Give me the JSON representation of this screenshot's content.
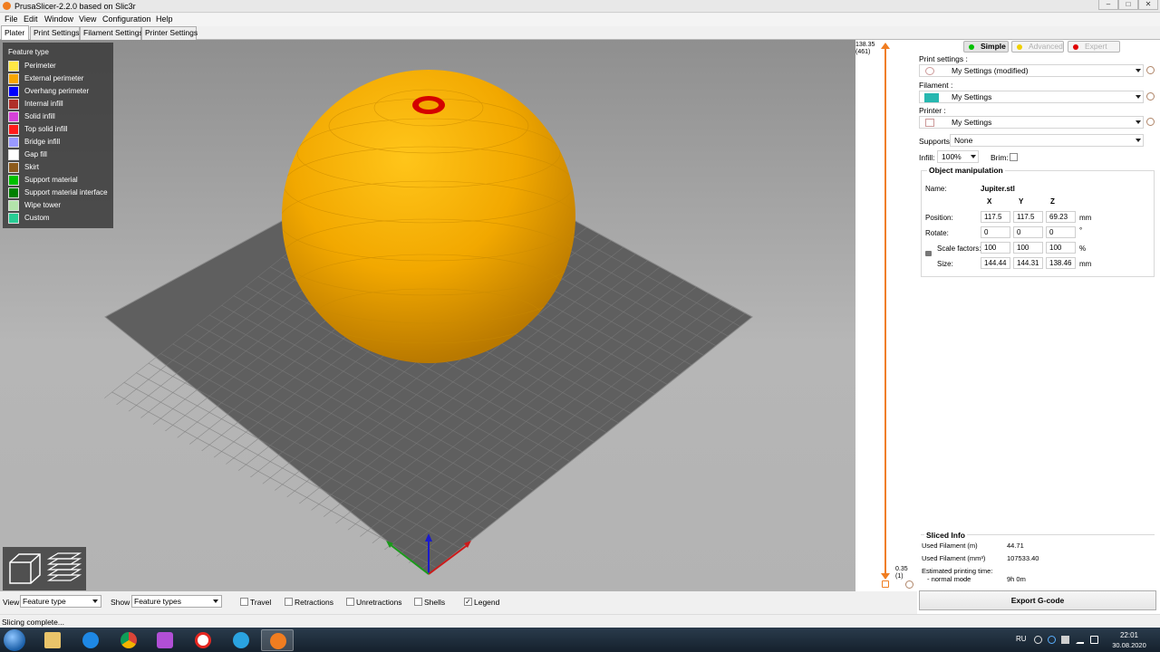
{
  "window": {
    "title": "PrusaSlicer-2.2.0 based on Slic3r"
  },
  "menu": {
    "items": [
      "File",
      "Edit",
      "Window",
      "View",
      "Configuration",
      "Help"
    ]
  },
  "tabs": [
    "Plater",
    "Print Settings",
    "Filament Settings",
    "Printer Settings"
  ],
  "legend": {
    "title": "Feature type",
    "items": [
      {
        "label": "Perimeter",
        "color": "#FFE845"
      },
      {
        "label": "External perimeter",
        "color": "#F7A600"
      },
      {
        "label": "Overhang perimeter",
        "color": "#0000FF"
      },
      {
        "label": "Internal infill",
        "color": "#B03029"
      },
      {
        "label": "Solid infill",
        "color": "#D641D9"
      },
      {
        "label": "Top solid infill",
        "color": "#FF1A1A"
      },
      {
        "label": "Bridge infill",
        "color": "#9999FF"
      },
      {
        "label": "Gap fill",
        "color": "#FFFFFF"
      },
      {
        "label": "Skirt",
        "color": "#8C5A1B"
      },
      {
        "label": "Support material",
        "color": "#00C000"
      },
      {
        "label": "Support material interface",
        "color": "#008000"
      },
      {
        "label": "Wipe tower",
        "color": "#B3E3AB"
      },
      {
        "label": "Custom",
        "color": "#28CC94"
      }
    ]
  },
  "layer_slider": {
    "top_height": "138.35",
    "top_layer": "(461)",
    "bottom_height": "0.35",
    "bottom_layer": "(1)"
  },
  "sidebar": {
    "modes": [
      {
        "label": "Simple",
        "color": "#00C000"
      },
      {
        "label": "Advanced",
        "color": "#F0D000"
      },
      {
        "label": "Expert",
        "color": "#E00000"
      }
    ],
    "print_settings_label": "Print settings :",
    "print_settings_value": "My Settings (modified)",
    "filament_label": "Filament :",
    "filament_value": "My Settings",
    "filament_color": "#27B7B0",
    "printer_label": "Printer :",
    "printer_value": "My Settings",
    "supports_label": "Supports:",
    "supports_value": "None",
    "infill_label": "Infill:",
    "infill_value": "100%",
    "brim_label": "Brim:",
    "object_manipulation": {
      "title": "Object manipulation",
      "name_label": "Name:",
      "name_value": "Jupiter.stl",
      "axis_x": "X",
      "axis_y": "Y",
      "axis_z": "Z",
      "position_label": "Position:",
      "position": [
        "117.5",
        "117.5",
        "69.23"
      ],
      "position_unit": "mm",
      "rotate_label": "Rotate:",
      "rotate": [
        "0",
        "0",
        "0"
      ],
      "rotate_unit": "°",
      "scale_label": "Scale factors:",
      "scale": [
        "100",
        "100",
        "100"
      ],
      "scale_unit": "%",
      "size_label": "Size:",
      "size": [
        "144.44",
        "144.31",
        "138.46"
      ],
      "size_unit": "mm"
    },
    "sliced_info": {
      "title": "Sliced Info",
      "used_filament_m_label": "Used Filament (m)",
      "used_filament_m": "44.71",
      "used_filament_mm3_label": "Used Filament (mm³)",
      "used_filament_mm3": "107533.40",
      "est_time_label": "Estimated printing time:",
      "normal_mode_label": "- normal mode",
      "normal_mode_value": "9h 0m"
    },
    "export_label": "Export G-code"
  },
  "bottombar": {
    "view_label": "View",
    "view_value": "Feature type",
    "show_label": "Show",
    "show_value": "Feature types",
    "checks": [
      {
        "label": "Travel",
        "checked": false
      },
      {
        "label": "Retractions",
        "checked": false
      },
      {
        "label": "Unretractions",
        "checked": false
      },
      {
        "label": "Shells",
        "checked": false
      },
      {
        "label": "Legend",
        "checked": true
      }
    ]
  },
  "status": {
    "text": "Slicing complete..."
  },
  "taskbar": {
    "language": "RU",
    "time": "22:01",
    "date": "30.08.2020"
  },
  "colors": {
    "accent": "#F07D20",
    "model": "#F2A800"
  }
}
